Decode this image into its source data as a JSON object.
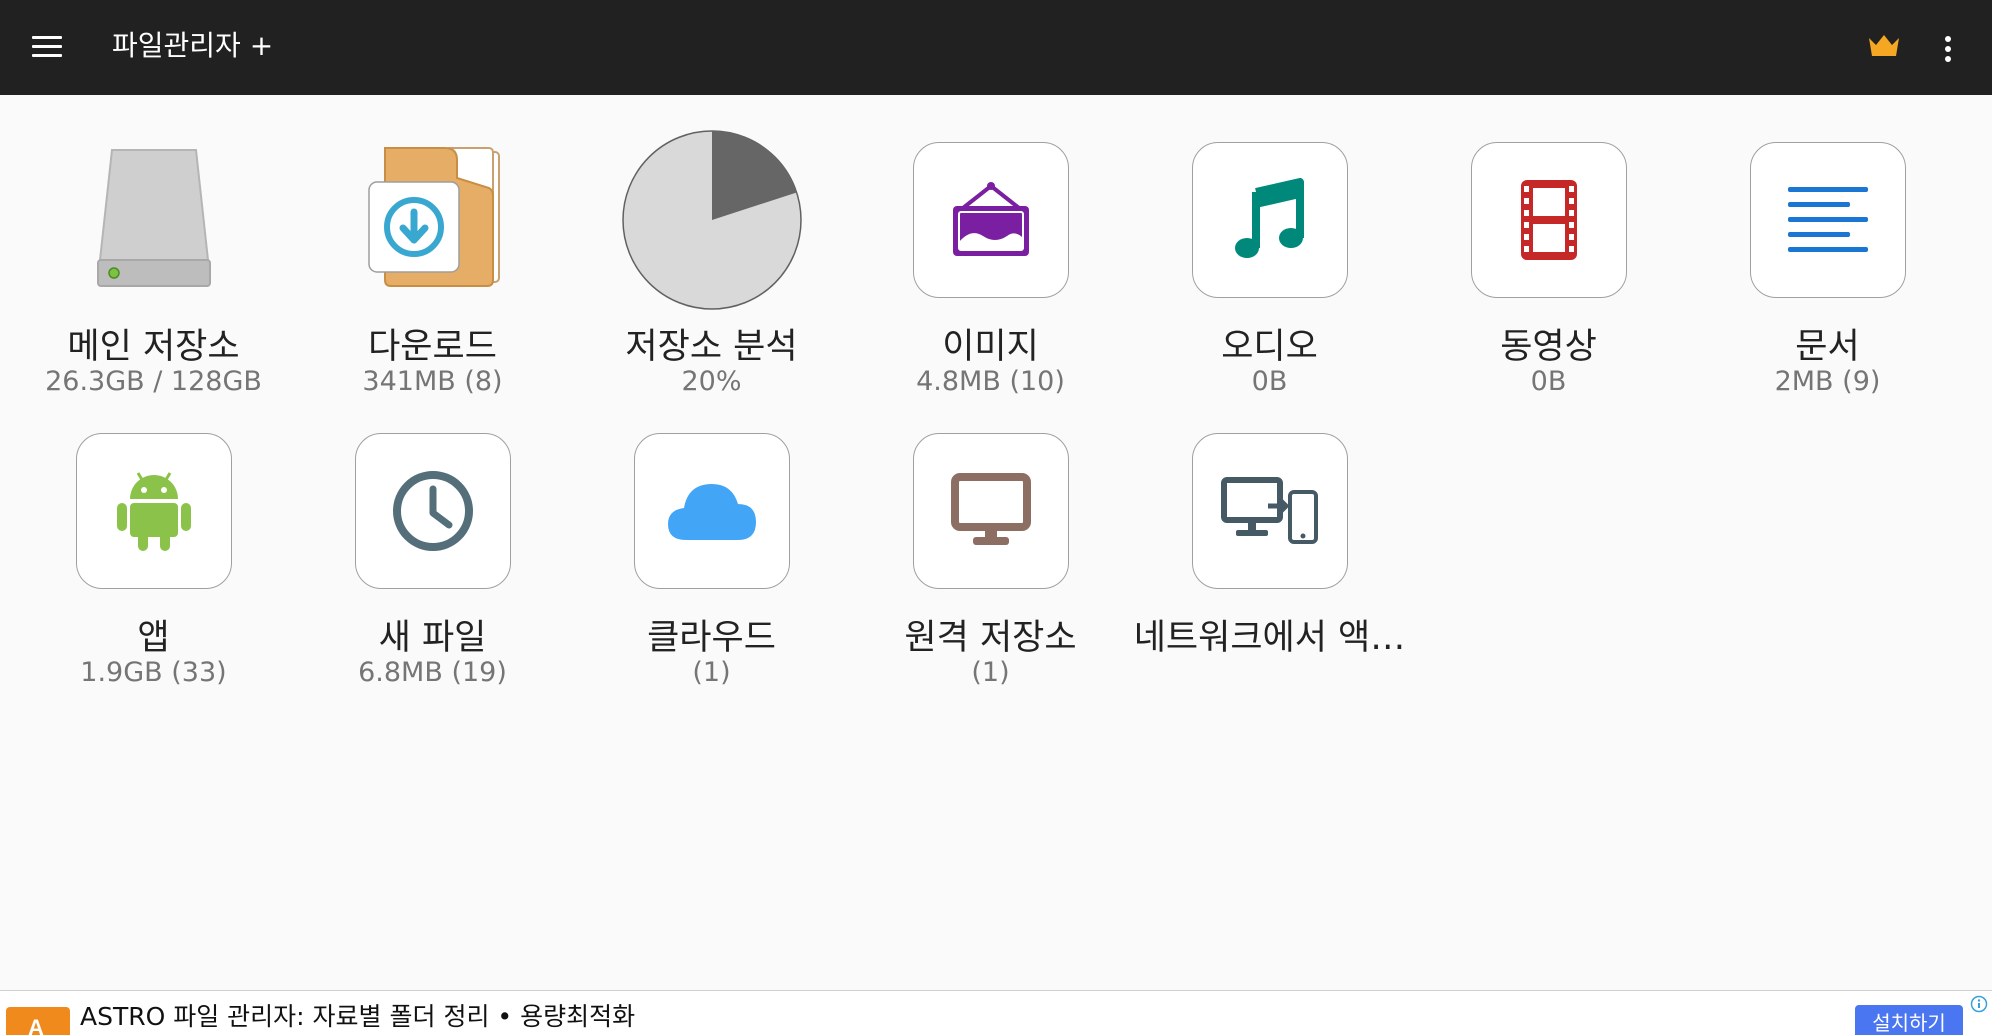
{
  "appbar": {
    "title": "파일관리자 +",
    "icons": {
      "menu": "hamburger-menu-icon",
      "premium": "crown-icon",
      "more": "more-vertical-icon"
    },
    "crown_color": "#f5a623"
  },
  "categories": [
    {
      "label": "메인 저장소",
      "sub": "26.3GB / 128GB",
      "icon": "hard-drive-icon"
    },
    {
      "label": "다운로드",
      "sub": "341MB (8)",
      "icon": "download-folder-icon"
    },
    {
      "label": "저장소 분석",
      "sub": "20%",
      "icon": "pie-chart-icon",
      "used_fraction": 0.2
    },
    {
      "label": "이미지",
      "sub": "4.8MB (10)",
      "icon": "image-frame-icon",
      "color": "#7b1fa2"
    },
    {
      "label": "오디오",
      "sub": "0B",
      "icon": "music-note-icon",
      "color": "#00897b"
    },
    {
      "label": "동영상",
      "sub": "0B",
      "icon": "film-strip-icon",
      "color": "#c62828"
    },
    {
      "label": "문서",
      "sub": "2MB (9)",
      "icon": "document-lines-icon",
      "color": "#1976d2"
    },
    {
      "label": "앱",
      "sub": "1.9GB (33)",
      "icon": "android-icon",
      "color": "#8bc34a"
    },
    {
      "label": "새 파일",
      "sub": "6.8MB (19)",
      "icon": "clock-icon",
      "color": "#546e7a"
    },
    {
      "label": "클라우드",
      "sub": "(1)",
      "icon": "cloud-icon",
      "color": "#42a5f5"
    },
    {
      "label": "원격 저장소",
      "sub": "(1)",
      "icon": "monitor-icon",
      "color": "#8d6e63"
    },
    {
      "label": "네트워크에서 액…",
      "sub": "",
      "icon": "network-devices-icon",
      "color": "#455a64"
    }
  ],
  "ad": {
    "text": "ASTRO 파일 관리자:  자료별 폴더 정리 • 용량최적화",
    "cta": "설치하기",
    "icon": "astro-app-logo-icon",
    "info_icon": "ad-info-icon",
    "cta_color": "#4a76f2"
  }
}
